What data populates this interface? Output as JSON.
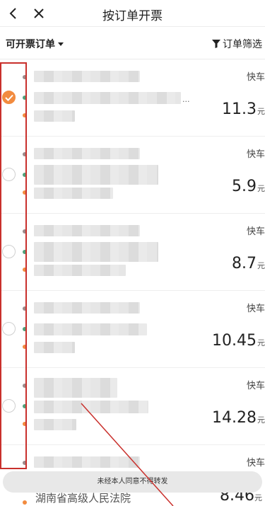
{
  "header": {
    "title": "按订单开票",
    "back_icon": "chevron-left-icon",
    "close_icon": "close-icon"
  },
  "filterbar": {
    "scope_label": "可开票订单",
    "filter_label": "订单筛选"
  },
  "orders": [
    {
      "type": "快车",
      "price": "11.3",
      "unit": "元",
      "checked": true,
      "ellipsis": "..."
    },
    {
      "type": "快车",
      "price": "5.9",
      "unit": "元",
      "checked": false
    },
    {
      "type": "快车",
      "price": "8.7",
      "unit": "元",
      "checked": false
    },
    {
      "type": "快车",
      "price": "10.45",
      "unit": "元",
      "checked": false
    },
    {
      "type": "快车",
      "price": "14.28",
      "unit": "元",
      "checked": false
    },
    {
      "type": "快车",
      "price": "8.46",
      "unit": "元",
      "checked": false
    }
  ],
  "partial_address": "湖南省高级人民法院",
  "toast": "未经本人同意不得转发",
  "colors": {
    "accent": "#f28b3f",
    "annotation": "#c9302c"
  }
}
